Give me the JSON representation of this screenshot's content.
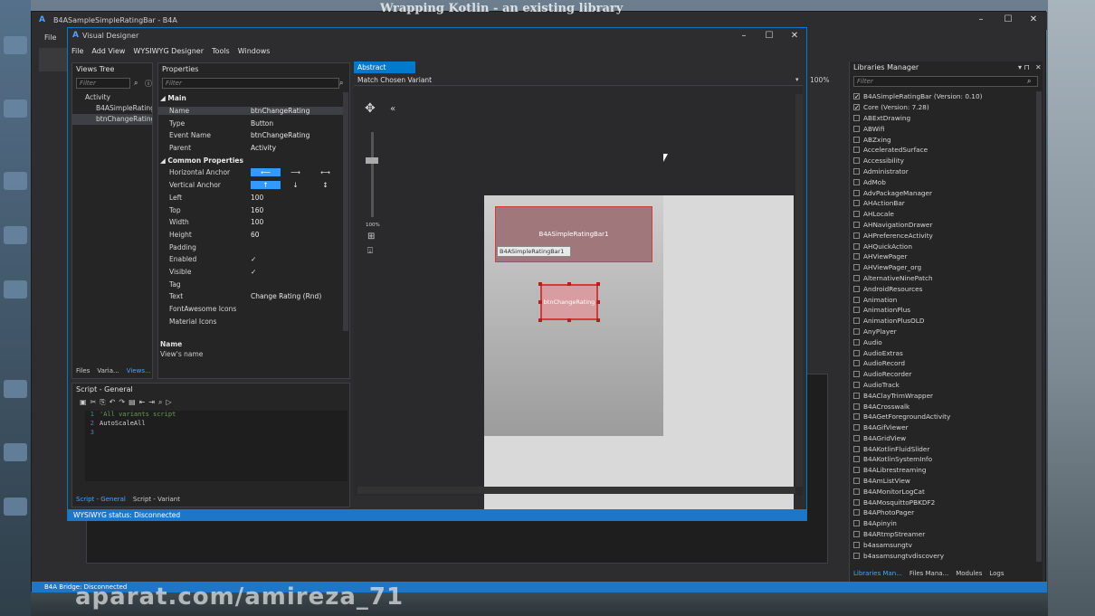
{
  "ide": {
    "title": "B4ASampleSimpleRatingBar - B4A",
    "banner": "Wrapping Kotlin - an existing library",
    "menu_file": "File",
    "status": "B4A Bridge: Disconnected",
    "zoom": "100%"
  },
  "visual_designer": {
    "title": "Visual Designer",
    "menu": [
      "File",
      "Add View",
      "WYSIWYG Designer",
      "Tools",
      "Windows"
    ],
    "status": "WYSIWYG status: Disconnected"
  },
  "views_tree": {
    "title": "Views Tree",
    "filter_placeholder": "Filter",
    "items": [
      "Activity",
      "B4ASimpleRatingBar1",
      "btnChangeRating"
    ],
    "tabs": [
      "Files",
      "Varia...",
      "Views..."
    ]
  },
  "properties": {
    "title": "Properties",
    "filter_placeholder": "Filter",
    "rows": [
      {
        "k": "Main",
        "v": "",
        "cat": true
      },
      {
        "k": "Name",
        "v": "btnChangeRating",
        "sel": true
      },
      {
        "k": "Type",
        "v": "Button"
      },
      {
        "k": "Event Name",
        "v": "btnChangeRating"
      },
      {
        "k": "Parent",
        "v": "Activity"
      },
      {
        "k": "Common Properties",
        "v": "",
        "cat": true
      },
      {
        "k": "Horizontal Anchor",
        "v": ""
      },
      {
        "k": "Vertical Anchor",
        "v": ""
      },
      {
        "k": "Left",
        "v": "100"
      },
      {
        "k": "Top",
        "v": "160"
      },
      {
        "k": "Width",
        "v": "100"
      },
      {
        "k": "Height",
        "v": "60"
      },
      {
        "k": "Padding",
        "v": ""
      },
      {
        "k": "Enabled",
        "v": "✓"
      },
      {
        "k": "Visible",
        "v": "✓"
      },
      {
        "k": "Tag",
        "v": ""
      },
      {
        "k": "Text",
        "v": "Change Rating (Rnd)"
      },
      {
        "k": "FontAwesome Icons",
        "v": ""
      },
      {
        "k": "Material Icons",
        "v": ""
      }
    ],
    "desc_title": "Name",
    "desc_text": "View's name"
  },
  "script": {
    "title": "Script - General",
    "lines": [
      "'All variants script",
      "AutoScaleAll",
      ""
    ],
    "tabs": [
      "Script - General",
      "Script - Variant"
    ]
  },
  "abstract_designer": {
    "tab": "Abstract Designer",
    "variant": "Match Chosen Variant",
    "zoom_label": "100%",
    "ratingbar_text": "B4ASimpleRatingBar1",
    "ratingbar_label": "B4ASimpleRatingBar1",
    "button_text": "btnChangeRating"
  },
  "libraries": {
    "title": "Libraries Manager",
    "filter_placeholder": "Filter",
    "items": [
      {
        "name": "B4ASimpleRatingBar (Version: 0.10)",
        "checked": true
      },
      {
        "name": "Core (Version: 7.28)",
        "checked": true
      },
      {
        "name": "ABExtDrawing"
      },
      {
        "name": "ABWifi"
      },
      {
        "name": "ABZxing"
      },
      {
        "name": "AcceleratedSurface"
      },
      {
        "name": "Accessibility"
      },
      {
        "name": "Administrator"
      },
      {
        "name": "AdMob"
      },
      {
        "name": "AdvPackageManager"
      },
      {
        "name": "AHActionBar"
      },
      {
        "name": "AHLocale"
      },
      {
        "name": "AHNavigationDrawer"
      },
      {
        "name": "AHPreferenceActivity"
      },
      {
        "name": "AHQuickAction"
      },
      {
        "name": "AHViewPager"
      },
      {
        "name": "AHViewPager_org"
      },
      {
        "name": "AlternativeNinePatch"
      },
      {
        "name": "AndroidResources"
      },
      {
        "name": "Animation"
      },
      {
        "name": "AnimationPlus"
      },
      {
        "name": "AnimationPlusOLD"
      },
      {
        "name": "AnyPlayer"
      },
      {
        "name": "Audio"
      },
      {
        "name": "AudioExtras"
      },
      {
        "name": "AudioRecord"
      },
      {
        "name": "AudioRecorder"
      },
      {
        "name": "AudioTrack"
      },
      {
        "name": "B4AClayTrimWrapper"
      },
      {
        "name": "B4ACrosswalk"
      },
      {
        "name": "B4AGetForegroundActivity"
      },
      {
        "name": "B4AGifViewer"
      },
      {
        "name": "B4AGridView"
      },
      {
        "name": "B4AKotlinFluidSlider"
      },
      {
        "name": "B4AKotlinSystemInfo"
      },
      {
        "name": "B4ALibrestreaming"
      },
      {
        "name": "B4AmListView"
      },
      {
        "name": "B4AMonitorLogCat"
      },
      {
        "name": "B4AMosquittoPBKDF2"
      },
      {
        "name": "B4APhotoPager"
      },
      {
        "name": "B4Apinyin"
      },
      {
        "name": "B4ARtmpStreamer"
      },
      {
        "name": "b4asamsungtv"
      },
      {
        "name": "b4asamsungtvdiscovery"
      }
    ],
    "tabs": [
      "Libraries Man...",
      "Files Mana...",
      "Modules",
      "Logs"
    ]
  },
  "watermark": "aparat.com/amireza_71"
}
